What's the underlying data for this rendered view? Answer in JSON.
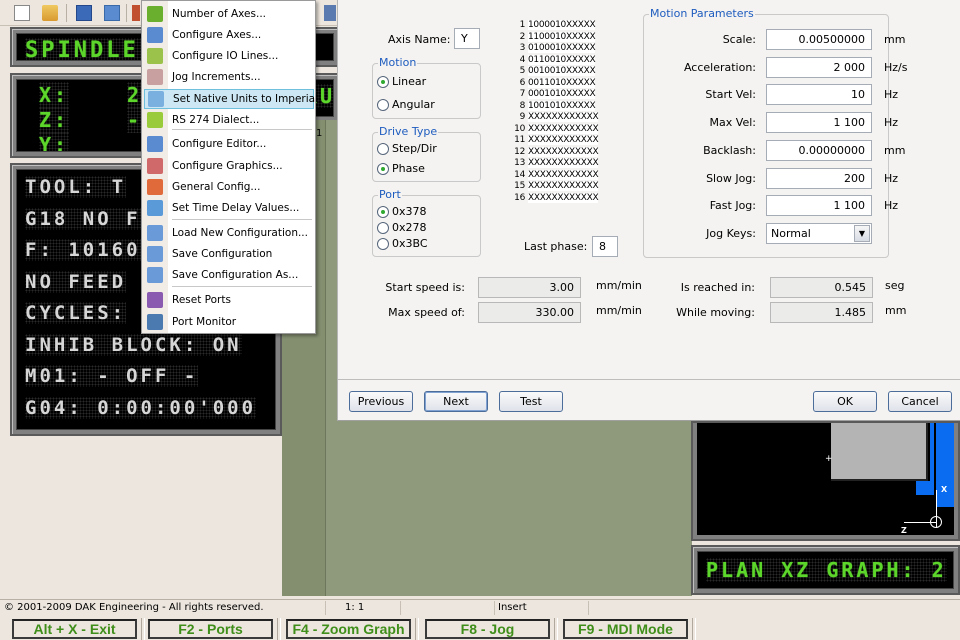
{
  "toolbar": {
    "icons": [
      "new-file-icon",
      "open-folder-icon",
      "save-icon",
      "save-all-icon",
      "cut-icon"
    ]
  },
  "left_panel": {
    "spindle_display": "SPINDLE:",
    "axes_display": [
      {
        "axis": "X:",
        "value": "2"
      },
      {
        "axis": "Z:",
        "value": "-"
      },
      {
        "axis": "Y:",
        "value": ""
      }
    ],
    "axes_right_partial": "RU",
    "status_lines": [
      "TOOL: T",
      "G18 NO F",
      "F: 10160",
      "NO FEED",
      "CYCLES:",
      "INHIB BLOCK: ON",
      "M01: - OFF -",
      "G04: 0:00:00'000"
    ]
  },
  "editor": {
    "line_number": "1"
  },
  "context_menu": {
    "items": [
      {
        "label": "Number of Axes...",
        "icon": "number-eight-icon",
        "color": "#6ab02e"
      },
      {
        "label": "Configure Axes...",
        "icon": "configure-axes-icon",
        "color": "#5a8ad0"
      },
      {
        "label": "Configure IO Lines...",
        "icon": "io-lines-icon",
        "color": "#9bc24a"
      },
      {
        "label": "Jog Increments...",
        "icon": "jog-increments-icon",
        "color": "#c8a0a0"
      },
      {
        "label": "Set Native Units to Imperial",
        "icon": "native-units-icon",
        "color": "#7ab0e0",
        "highlighted": true
      },
      {
        "label": "RS 274 Dialect...",
        "icon": "rs274-book-icon",
        "color": "#9acb3a"
      },
      {
        "label": "Configure Editor...",
        "icon": "configure-editor-icon",
        "color": "#5a8ad0"
      },
      {
        "label": "Configure Graphics...",
        "icon": "configure-graphics-icon",
        "color": "#d06a6a"
      },
      {
        "label": "General Config...",
        "icon": "general-config-icon",
        "color": "#e06a3a"
      },
      {
        "label": "Set Time Delay Values...",
        "icon": "time-delay-icon",
        "color": "#5a9ad8"
      },
      {
        "label": "Load New Configuration...",
        "icon": "load-config-icon",
        "color": "#6a9ad8"
      },
      {
        "label": "Save Configuration",
        "icon": "save-config-icon",
        "color": "#6a9ad8"
      },
      {
        "label": "Save Configuration As...",
        "icon": "save-config-as-icon",
        "color": "#6a9ad8"
      },
      {
        "label": "Reset Ports",
        "icon": "bug-icon",
        "color": "#8a5ab0"
      },
      {
        "label": "Port Monitor",
        "icon": "eye-icon",
        "color": "#4a7ab0"
      }
    ]
  },
  "dialog": {
    "axis_name_label": "Axis Name:",
    "axis_name_value": "Y",
    "motion": {
      "title": "Motion",
      "options": [
        {
          "label": "Linear",
          "selected": true
        },
        {
          "label": "Angular",
          "selected": false
        }
      ]
    },
    "drive_type": {
      "title": "Drive Type",
      "options": [
        {
          "label": "Step/Dir",
          "selected": false
        },
        {
          "label": "Phase",
          "selected": true
        }
      ]
    },
    "port": {
      "title": "Port",
      "options": [
        {
          "label": "0x378",
          "selected": true
        },
        {
          "label": "0x278",
          "selected": false
        },
        {
          "label": "0x3BC",
          "selected": false
        }
      ]
    },
    "phases": [
      {
        "n": "1",
        "v": "1000010XXXXX"
      },
      {
        "n": "2",
        "v": "1100010XXXXX"
      },
      {
        "n": "3",
        "v": "0100010XXXXX"
      },
      {
        "n": "4",
        "v": "0110010XXXXX"
      },
      {
        "n": "5",
        "v": "0010010XXXXX"
      },
      {
        "n": "6",
        "v": "0011010XXXXX"
      },
      {
        "n": "7",
        "v": "0001010XXXXX"
      },
      {
        "n": "8",
        "v": "1001010XXXXX"
      },
      {
        "n": "9",
        "v": "XXXXXXXXXXXX"
      },
      {
        "n": "10",
        "v": "XXXXXXXXXXXX"
      },
      {
        "n": "11",
        "v": "XXXXXXXXXXXX"
      },
      {
        "n": "12",
        "v": "XXXXXXXXXXXX"
      },
      {
        "n": "13",
        "v": "XXXXXXXXXXXX"
      },
      {
        "n": "14",
        "v": "XXXXXXXXXXXX"
      },
      {
        "n": "15",
        "v": "XXXXXXXXXXXX"
      },
      {
        "n": "16",
        "v": "XXXXXXXXXXXX"
      }
    ],
    "last_phase_label": "Last phase:",
    "last_phase_value": "8",
    "motion_parameters": {
      "title": "Motion Parameters",
      "fields": [
        {
          "label": "Scale:",
          "value": "0.00500000",
          "unit": "mm"
        },
        {
          "label": "Acceleration:",
          "value": "2 000",
          "unit": "Hz/s"
        },
        {
          "label": "Start Vel:",
          "value": "10",
          "unit": "Hz"
        },
        {
          "label": "Max Vel:",
          "value": "1 100",
          "unit": "Hz"
        },
        {
          "label": "Backlash:",
          "value": "0.00000000",
          "unit": "mm"
        },
        {
          "label": "Slow Jog:",
          "value": "200",
          "unit": "Hz"
        },
        {
          "label": "Fast Jog:",
          "value": "1 100",
          "unit": "Hz"
        }
      ],
      "jog_keys_label": "Jog Keys:",
      "jog_keys_value": "Normal"
    },
    "readouts": [
      {
        "label": "Start speed is:",
        "value": "3.00",
        "unit": "mm/min"
      },
      {
        "label": "Max speed of:",
        "value": "330.00",
        "unit": "mm/min"
      },
      {
        "label": "Is reached in:",
        "value": "0.545",
        "unit": "seg"
      },
      {
        "label": "While moving:",
        "value": "1.485",
        "unit": "mm"
      }
    ],
    "buttons": {
      "previous": "Previous",
      "next": "Next",
      "test": "Test",
      "ok": "OK",
      "cancel": "Cancel"
    }
  },
  "graph": {
    "axis_x_label": "X",
    "axis_z_label": "Z",
    "part_color": "#b4b4b4",
    "tool_color": "#0a6cf0",
    "mode_display": "PLAN XZ GRAPH: 2"
  },
  "status_bar": {
    "copyright": "© 2001-2009 DAK Engineering - All rights reserved.",
    "position": "1: 1",
    "mode": "Insert"
  },
  "function_keys": [
    {
      "label": "Alt + X - Exit"
    },
    {
      "label": "F2 - Ports"
    },
    {
      "label": "F4 - Zoom Graph"
    },
    {
      "label": "F8 - Jog"
    },
    {
      "label": "F9 - MDI Mode"
    }
  ]
}
